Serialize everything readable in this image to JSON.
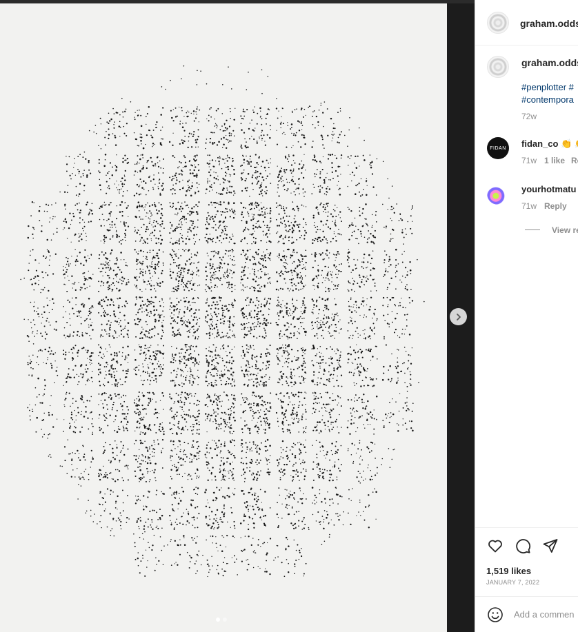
{
  "post": {
    "author": "graham.odds",
    "caption_author": "graham.odds",
    "caption_tags": [
      "#penplotter #",
      "#contempora"
    ],
    "caption_age": "72w",
    "likes": "1,519 likes",
    "date": "JANUARY 7, 2022",
    "media_slides": 2,
    "media_active_slide": 1
  },
  "comments": [
    {
      "user": "fidan_co",
      "emoji": "👏 👏",
      "avatar_text": "FIDAN",
      "age": "71w",
      "likes": "1 like",
      "reply": "Re"
    },
    {
      "user": "yourhotmatu",
      "age": "71w",
      "reply": "Reply"
    }
  ],
  "view_replies": "View re",
  "composer": {
    "placeholder": "Add a commen"
  },
  "icons": {
    "like": "heart-icon",
    "comment": "comment-icon",
    "share": "send-icon",
    "emoji": "smiley-icon",
    "next": "chevron-right-icon"
  },
  "colors": {
    "hashtag": "#00376b",
    "muted": "#8e8e8e",
    "text": "#262626"
  }
}
